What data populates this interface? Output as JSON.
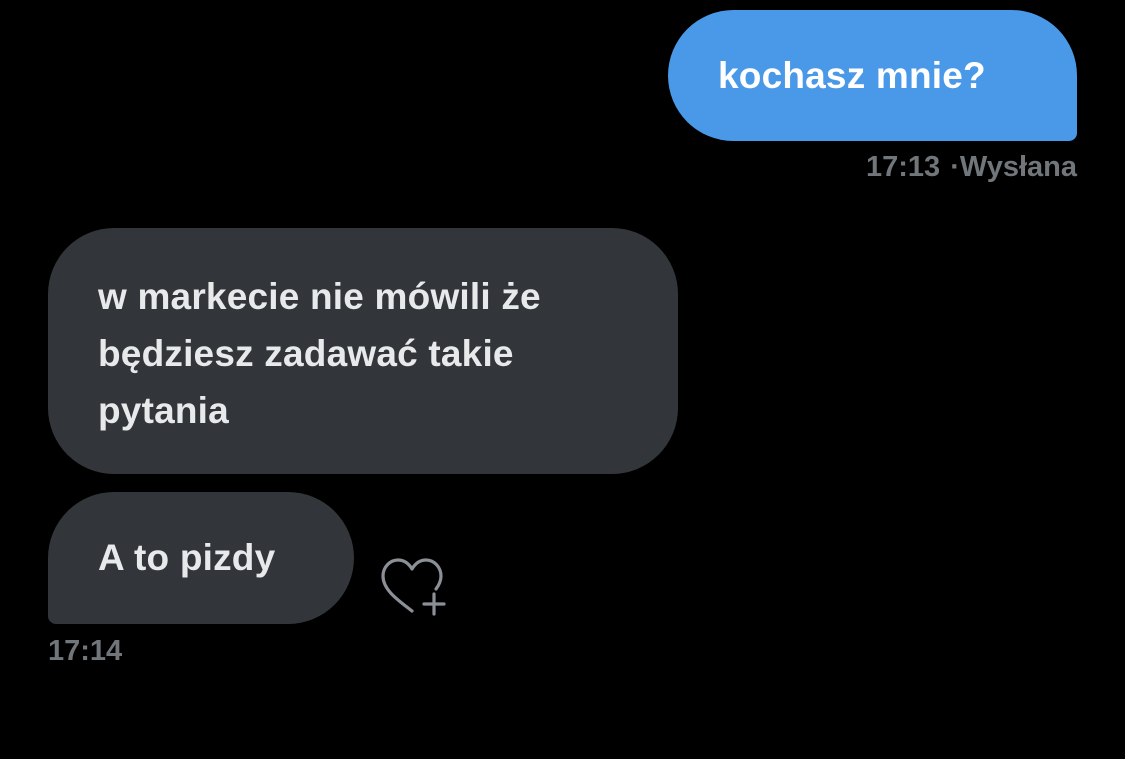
{
  "conversation": {
    "messages": [
      {
        "direction": "sent",
        "text": "kochasz mnie?",
        "time": "17:13",
        "status": "Wysłana"
      },
      {
        "direction": "received",
        "text": "w markecie nie mówili że będziesz zadawać takie pytania"
      },
      {
        "direction": "received",
        "text": "A to pizdy",
        "time": "17:14"
      }
    ],
    "meta_separator": "·"
  },
  "colors": {
    "background": "#000000",
    "sent_bubble": "#4a99e9",
    "received_bubble": "#323539",
    "meta_text": "#71767b"
  },
  "icons": {
    "reaction": "heart-plus-icon"
  }
}
